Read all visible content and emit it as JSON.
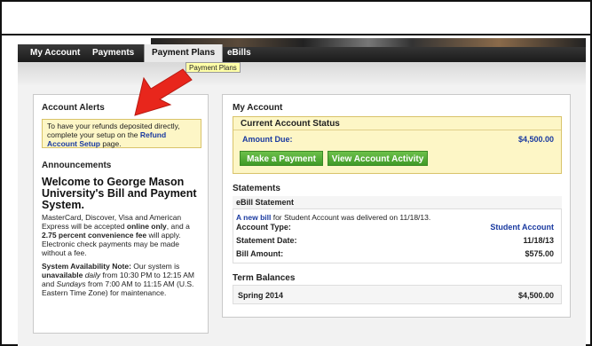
{
  "nav": {
    "items": [
      "My Account",
      "Payments",
      "Payment Plans",
      "eBills"
    ],
    "active": "Payment Plans",
    "tooltip": "Payment Plans"
  },
  "alerts": {
    "title": "Account Alerts",
    "text_before": "To have your refunds deposited directly, complete your setup on the ",
    "link": "Refund Account Setup",
    "text_after": " page."
  },
  "announcements": {
    "title": "Announcements",
    "headline": "Welcome to George Mason University's Bill and Payment System.",
    "p1_a": "MasterCard, Discover, Visa and American Express will be accepted ",
    "p1_bold1": "online only",
    "p1_b": ", and a ",
    "p1_bold2": "2.75 percent convenience fee",
    "p1_c": " will apply. Electronic check payments may be made without a fee.",
    "p2_bold": "System Availability Note:",
    "p2_a": " Our system is ",
    "p2_bold2": "unavailable",
    "p2_b": " ",
    "p2_it1": "daily",
    "p2_c": " from 10:30 PM to 12:15 AM and ",
    "p2_it2": "Sundays",
    "p2_d": " from 7:00 AM to 11:15 AM (U.S. Eastern Time Zone) for maintenance."
  },
  "account": {
    "title": "My Account",
    "status_title": "Current Account Status",
    "amount_due_label": "Amount Due:",
    "amount_due": "$4,500.00",
    "make_payment": "Make a Payment",
    "view_activity": "View Account Activity"
  },
  "statements": {
    "title": "Statements",
    "ebill_title": "eBill Statement",
    "new_bill_link": "A new bill",
    "new_bill_text": " for Student Account was delivered on 11/18/13.",
    "type_label": "Account Type:",
    "type_value": "Student Account",
    "date_label": "Statement Date:",
    "date_value": "11/18/13",
    "amount_label": "Bill Amount:",
    "amount_value": "$575.00"
  },
  "terms": {
    "title": "Term Balances",
    "term": "Spring 2014",
    "balance": "$4,500.00"
  },
  "colors": {
    "accent_green": "#4caf2f",
    "link_blue": "#1a3aa0",
    "alert_yellow": "#fdf6c6",
    "arrow_red": "#e8261c"
  }
}
